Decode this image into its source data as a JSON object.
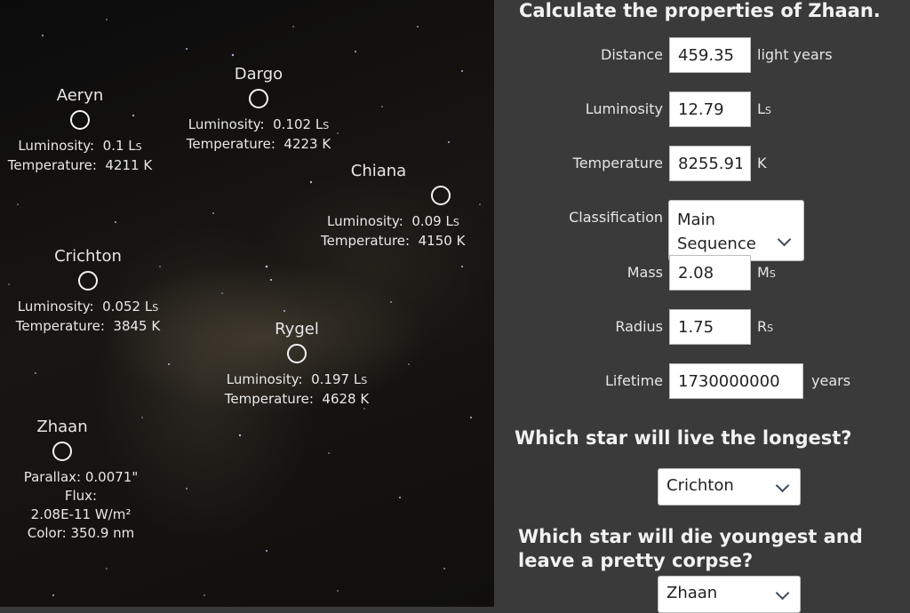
{
  "stars": [
    {
      "name": "Aeryn",
      "lum_label": "Luminosity:",
      "lum": "0.1 L",
      "temp_label": "Temperature:",
      "temp": "4211 K"
    },
    {
      "name": "Dargo",
      "lum_label": "Luminosity:",
      "lum": "0.102 L",
      "temp_label": "Temperature:",
      "temp": "4223 K"
    },
    {
      "name": "Chiana",
      "lum_label": "Luminosity:",
      "lum": "0.09 L",
      "temp_label": "Temperature:",
      "temp": "4150 K"
    },
    {
      "name": "Crichton",
      "lum_label": "Luminosity:",
      "lum": "0.052 L",
      "temp_label": "Temperature:",
      "temp": "3845 K"
    },
    {
      "name": "Rygel",
      "lum_label": "Luminosity:",
      "lum": "0.197 L",
      "temp_label": "Temperature:",
      "temp": "4628 K"
    }
  ],
  "sun_subscript": "S",
  "zhaan": {
    "name": "Zhaan",
    "parallax": "Parallax:  0.0071\"",
    "flux_label": "Flux:",
    "flux": "2.08E-11 W/m²",
    "color": "Color:  350.9 nm"
  },
  "panel": {
    "title": "Calculate the properties of Zhaan.",
    "distance": {
      "label": "Distance",
      "value": "459.35",
      "unit": "light years"
    },
    "luminosity": {
      "label": "Luminosity",
      "value": "12.79",
      "unit": "L"
    },
    "temperature": {
      "label": "Temperature",
      "value": "8255.91",
      "unit": "K"
    },
    "classification": {
      "label": "Classification",
      "value_line1": "Main",
      "value_line2": "Sequence"
    },
    "mass": {
      "label": "Mass",
      "value": "2.08",
      "unit": "M"
    },
    "radius": {
      "label": "Radius",
      "value": "1.75",
      "unit": "R"
    },
    "lifetime": {
      "label": "Lifetime",
      "value": "1730000000",
      "unit": "years"
    },
    "q1": "Which star will live the longest?",
    "q1_answer": "Crichton",
    "q2": "Which star will die youngest and leave a pretty corpse?",
    "q2_answer": "Zhaan"
  }
}
